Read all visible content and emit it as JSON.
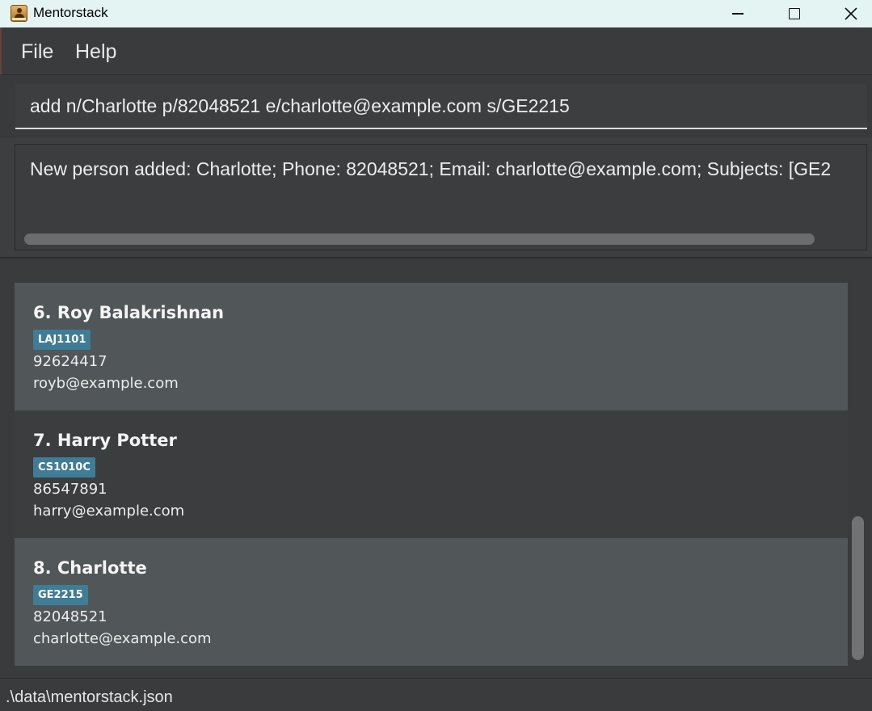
{
  "window": {
    "title": "Mentorstack",
    "icon": "address-book-icon"
  },
  "menu": {
    "file_label": "File",
    "help_label": "Help"
  },
  "command": {
    "value": "add n/Charlotte p/82048521 e/charlotte@example.com s/GE2215"
  },
  "result": {
    "text": "New person added: Charlotte; Phone: 82048521; Email: charlotte@example.com; Subjects: [GE2"
  },
  "persons": [
    {
      "name": "6. Roy Balakrishnan",
      "subject": "LAJ1101",
      "phone": "92624417",
      "email": "royb@example.com"
    },
    {
      "name": "7. Harry Potter",
      "subject": "CS1010C",
      "phone": "86547891",
      "email": "harry@example.com"
    },
    {
      "name": "8. Charlotte",
      "subject": "GE2215",
      "phone": "82048521",
      "email": "charlotte@example.com"
    }
  ],
  "status": {
    "path": ".\\data\\mentorstack.json"
  },
  "colors": {
    "background": "#3c3e3f",
    "card_light": "#515658",
    "card_dark": "#3b3d3e",
    "tag": "#3f7d96",
    "titlebar": "#e4f4f3"
  }
}
